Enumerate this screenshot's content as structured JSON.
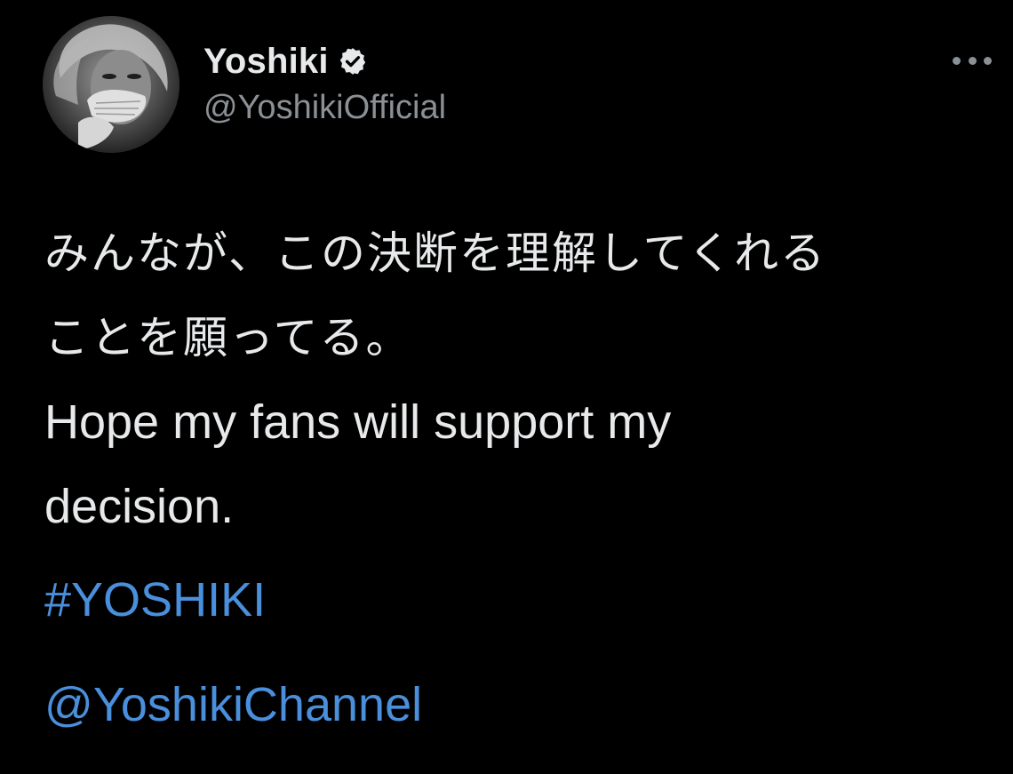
{
  "author": {
    "display_name": "Yoshiki",
    "handle": "@YoshikiOfficial",
    "avatar_icon": "profile-photo",
    "verified": true,
    "verified_icon": "verified-badge-icon"
  },
  "menu": {
    "more_icon": "ellipsis-icon"
  },
  "tweet": {
    "lines": [
      "みんなが、この決断を理解してくれる",
      "ことを願ってる。",
      "Hope my fans will support my",
      "decision."
    ],
    "hashtag": "#YOSHIKI",
    "mention": "@YoshikiChannel"
  },
  "colors": {
    "background": "#000000",
    "text": "#e7e9ea",
    "secondary_text": "#8b9095",
    "link": "#4a8fdc"
  }
}
